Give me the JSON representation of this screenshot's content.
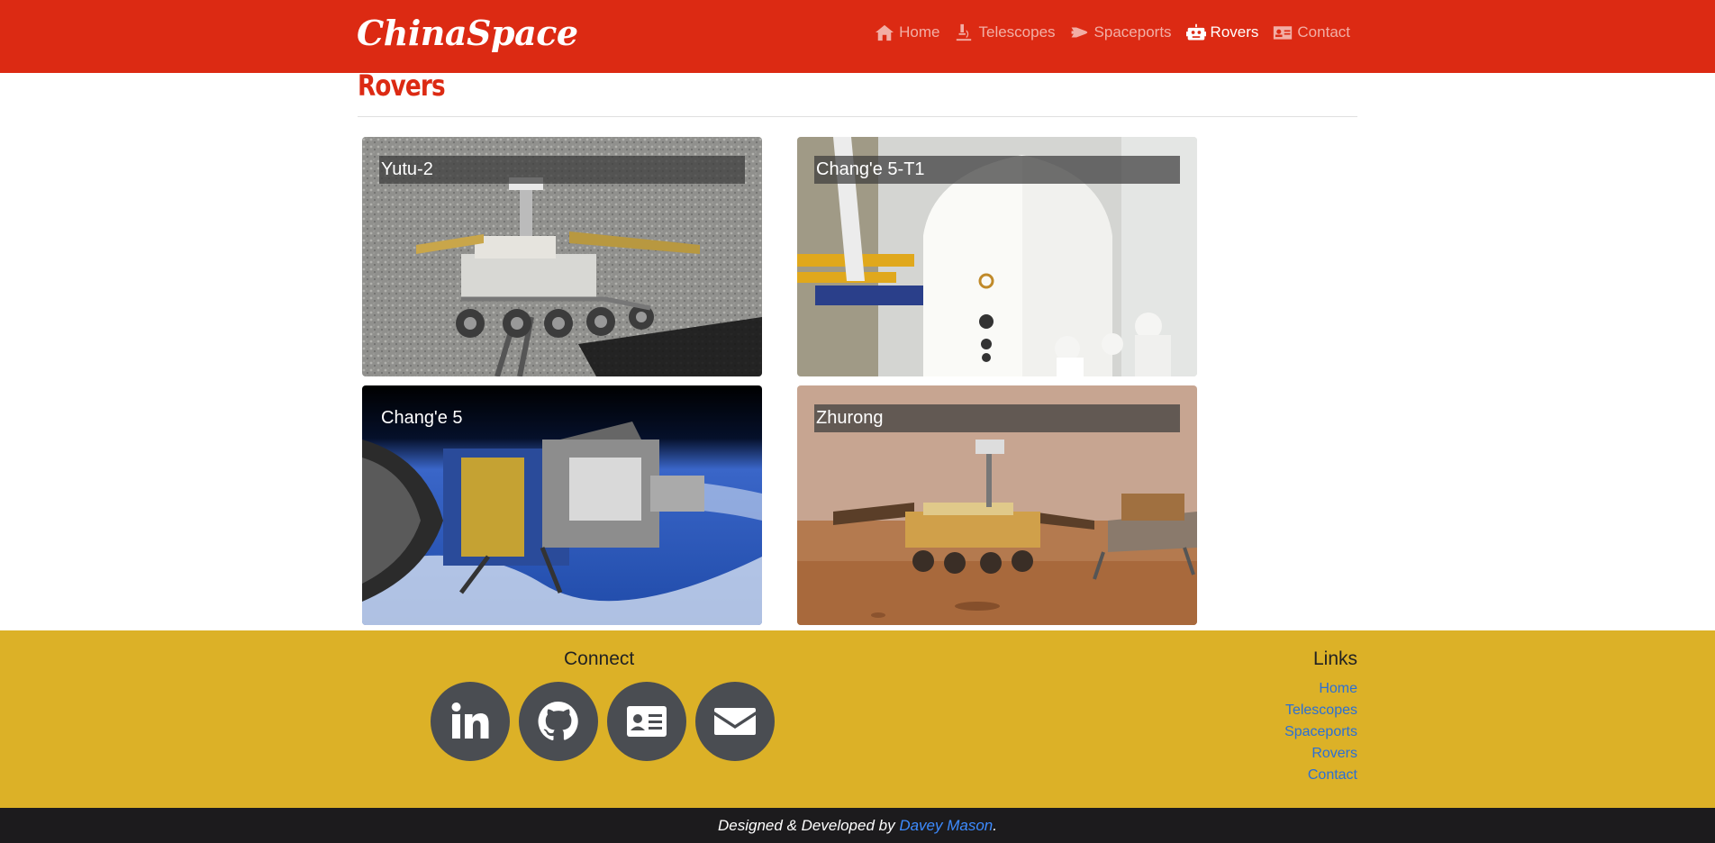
{
  "brand": "ChinaSpace",
  "nav": [
    {
      "label": "Home",
      "icon": "home-icon",
      "active": false
    },
    {
      "label": "Telescopes",
      "icon": "microscope-icon",
      "active": false
    },
    {
      "label": "Spaceports",
      "icon": "space-shuttle-icon",
      "active": false
    },
    {
      "label": "Rovers",
      "icon": "robot-icon",
      "active": true
    },
    {
      "label": "Contact",
      "icon": "id-card-icon",
      "active": false
    }
  ],
  "page_title": "Rovers",
  "cards": [
    {
      "title": "Yutu-2"
    },
    {
      "title": "Chang'e 5-T1"
    },
    {
      "title": "Chang'e 5"
    },
    {
      "title": "Zhurong"
    }
  ],
  "footer": {
    "connect_title": "Connect",
    "social": [
      "linkedin-icon",
      "github-icon",
      "id-card-icon",
      "envelope-icon"
    ],
    "links_title": "Links",
    "links": [
      "Home",
      "Telescopes",
      "Spaceports",
      "Rovers",
      "Contact"
    ]
  },
  "credits": {
    "prefix": "Designed & Developed by ",
    "author": "Davey Mason",
    "suffix": "."
  },
  "colors": {
    "navbar": "#dc2a13",
    "footer": "#dcb127",
    "credits_bar": "#1c1b1d",
    "link": "#2a6fd6"
  }
}
